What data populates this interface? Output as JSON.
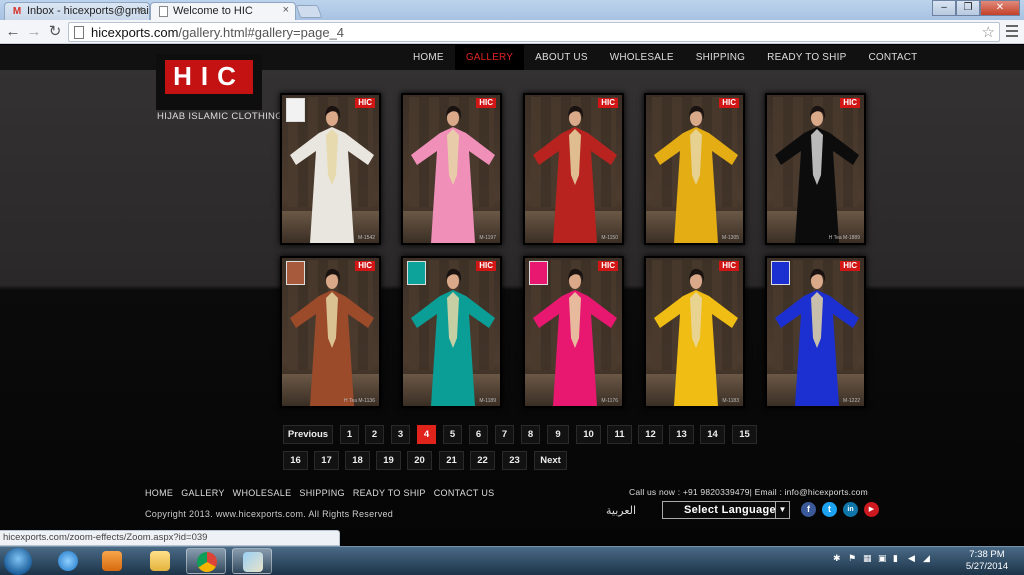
{
  "browser": {
    "tabs": [
      {
        "title": "Inbox - hicexports@gmai",
        "icon": "gmail-icon"
      },
      {
        "title": "Welcome to HIC",
        "icon": "page-icon"
      }
    ],
    "url_domain": "hicexports.com",
    "url_path": "/gallery.html#gallery=page_4"
  },
  "site": {
    "nav": [
      "HOME",
      "GALLERY",
      "ABOUT US",
      "WHOLESALE",
      "SHIPPING",
      "READY TO SHIP",
      "CONTACT"
    ],
    "active_nav": "GALLERY",
    "logo_text": "HIC",
    "tagline": "HIJAB ISLAMIC CLOTHING",
    "badge_text": "HIC",
    "gallery": [
      {
        "code": "M-1542",
        "color": "#e9e6df",
        "swatch": "#f2f2f2"
      },
      {
        "code": "M-1197",
        "color": "#f090b8",
        "swatch": ""
      },
      {
        "code": "M-1150",
        "color": "#b8231f",
        "swatch": ""
      },
      {
        "code": "M-1305",
        "color": "#e4ad14",
        "swatch": ""
      },
      {
        "code": "H Tea M-1889",
        "color": "#0c0c0c",
        "swatch": ""
      },
      {
        "code": "H Tea M-1136",
        "color": "#9b4a2a",
        "swatch": "#a85a3c"
      },
      {
        "code": "M-1189",
        "color": "#0b9e96",
        "swatch": "#0ea39a"
      },
      {
        "code": "M-1176",
        "color": "#e8176f",
        "swatch": "#e8176f"
      },
      {
        "code": "M-1183",
        "color": "#f0bd14",
        "swatch": ""
      },
      {
        "code": "M-1222",
        "color": "#1c2fd0",
        "swatch": "#1c2fd0"
      }
    ],
    "pagination": {
      "previous": "Previous",
      "next": "Next",
      "row1": [
        "1",
        "2",
        "3",
        "4",
        "5",
        "6",
        "7",
        "8",
        "9",
        "10",
        "11",
        "12",
        "13",
        "14",
        "15"
      ],
      "row2": [
        "16",
        "17",
        "18",
        "19",
        "20",
        "21",
        "22",
        "23"
      ],
      "current": "4"
    },
    "footer": {
      "links": [
        "HOME",
        "GALLERY",
        "WHOLESALE",
        "SHIPPING",
        "READY TO SHIP",
        "CONTACT US"
      ],
      "copyright": "Copyright 2013. www.hicexports.com. All Rights Reserved",
      "call_us": "Call us now : +91 9820339479| Email :  info@hicexports.com",
      "arabic": "العربية",
      "language_select": "Select Language",
      "social": [
        {
          "name": "facebook",
          "glyph": "f",
          "color": "#3b5998"
        },
        {
          "name": "twitter",
          "glyph": "t",
          "color": "#1da1f2"
        },
        {
          "name": "linkedin",
          "glyph": "in",
          "color": "#0e76a8"
        },
        {
          "name": "youtube",
          "glyph": "▶",
          "color": "#cc181e"
        }
      ]
    }
  },
  "status_url": "hicexports.com/zoom-effects/Zoom.aspx?id=039",
  "taskbar": {
    "time": "7:38 PM",
    "date": "5/27/2014"
  }
}
